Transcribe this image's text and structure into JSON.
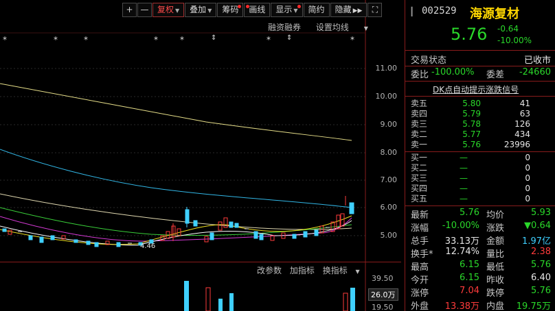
{
  "toolbar": {
    "plus": "+",
    "minus": "—",
    "restore_rights": "复权",
    "overlay": "叠加",
    "chips": "筹码",
    "draw": "画线",
    "display": "显示",
    "simple": "简约",
    "hide": "隐藏",
    "forward_arrows": "▶▶",
    "fullscreen": "⛶"
  },
  "upper_links": {
    "margin": "融资融券",
    "set_ma": "设置均线"
  },
  "price_axis": [
    "11.00",
    "10.00",
    "9.00",
    "8.00",
    "7.00",
    "6.00",
    "5.00"
  ],
  "markers": {
    "star": "*",
    "arrow": "⇕"
  },
  "low_marker": "4.46",
  "sub_links": {
    "params": "改参数",
    "add_indicator": "加指标",
    "switch_indicator": "换指标"
  },
  "sub_axis": {
    "top": "39.50",
    "current": "26.0万",
    "bottom": "19.50"
  },
  "quote": {
    "code": "002529",
    "name": "海源复材",
    "price": "5.76",
    "change": "-0.64",
    "change_pct": "-10.00%",
    "trade_status_label": "交易状态",
    "trade_status": "已收市",
    "bid_ratio_label": "委比",
    "bid_ratio": "-100.00%",
    "bid_diff_label": "委差",
    "bid_diff": "-24660",
    "dk_link": "DK点自动提示涨跌信号",
    "asks": [
      {
        "label": "卖五",
        "price": "5.80",
        "vol": "41"
      },
      {
        "label": "卖四",
        "price": "5.79",
        "vol": "63"
      },
      {
        "label": "卖三",
        "price": "5.78",
        "vol": "126"
      },
      {
        "label": "卖二",
        "price": "5.77",
        "vol": "434"
      },
      {
        "label": "卖一",
        "price": "5.76",
        "vol": "23996"
      }
    ],
    "bids": [
      {
        "label": "买一",
        "price": "—",
        "vol": "0"
      },
      {
        "label": "买二",
        "price": "—",
        "vol": "0"
      },
      {
        "label": "买三",
        "price": "—",
        "vol": "0"
      },
      {
        "label": "买四",
        "price": "—",
        "vol": "0"
      },
      {
        "label": "买五",
        "price": "—",
        "vol": "0"
      }
    ],
    "stats": [
      {
        "k1": "最新",
        "v1": "5.76",
        "c1": "green",
        "k2": "均价",
        "v2": "5.93",
        "c2": "green"
      },
      {
        "k1": "涨幅",
        "v1": "-10.00%",
        "c1": "green",
        "k2": "涨跌",
        "v2": "▼0.64",
        "c2": "green"
      },
      {
        "k1": "总手",
        "v1": "33.13万",
        "c1": "white",
        "k2": "金额",
        "v2": "1.97亿",
        "c2": "cyan"
      },
      {
        "k1": "换手*",
        "v1": "12.74%",
        "c1": "white",
        "k2": "量比",
        "v2": "2.38",
        "c2": "red"
      },
      {
        "k1": "最高",
        "v1": "6.15",
        "c1": "green",
        "k2": "最低",
        "v2": "5.76",
        "c2": "green"
      },
      {
        "k1": "今开",
        "v1": "6.15",
        "c1": "green",
        "k2": "昨收",
        "v2": "6.40",
        "c2": "white"
      },
      {
        "k1": "涨停",
        "v1": "7.04",
        "c1": "red",
        "k2": "跌停",
        "v2": "5.76",
        "c2": "green"
      },
      {
        "k1": "外盘",
        "v1": "13.38万",
        "c1": "red",
        "k2": "内盘",
        "v2": "19.75万",
        "c2": "green"
      }
    ]
  },
  "colors": {
    "up": "#ff3b3b",
    "down": "#2ad82a",
    "flat_cyan": "#3fd0ff",
    "border": "#8a1c1c"
  }
}
